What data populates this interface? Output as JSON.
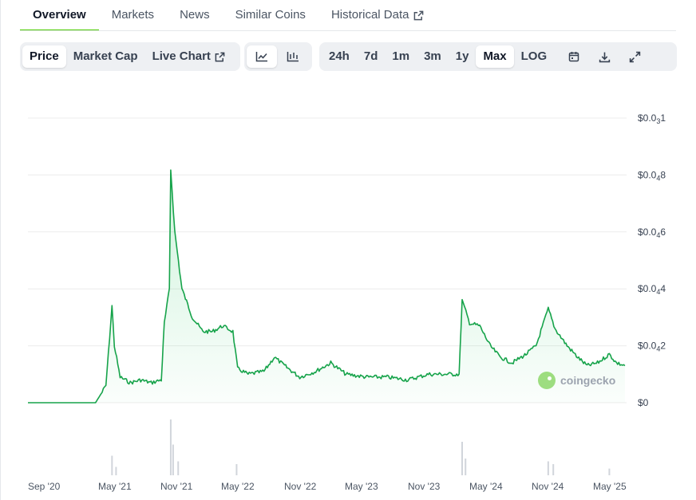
{
  "tabs": [
    {
      "label": "Overview"
    },
    {
      "label": "Markets"
    },
    {
      "label": "News"
    },
    {
      "label": "Similar Coins"
    },
    {
      "label": "Historical Data"
    }
  ],
  "toolbar": {
    "metric_buttons": [
      {
        "label": "Price"
      },
      {
        "label": "Market Cap"
      },
      {
        "label": "Live Chart"
      }
    ],
    "chart_style_icons": [
      "line-chart-icon",
      "candlestick-chart-icon"
    ],
    "range_buttons": [
      {
        "label": "24h"
      },
      {
        "label": "7d"
      },
      {
        "label": "1m"
      },
      {
        "label": "3m"
      },
      {
        "label": "1y"
      },
      {
        "label": "Max"
      },
      {
        "label": "LOG"
      }
    ],
    "selected_metric": "Price",
    "selected_range": "Max",
    "selected_style": "line",
    "tool_icons": [
      "calendar-icon",
      "download-icon",
      "fullscreen-icon"
    ]
  },
  "watermark": {
    "text": "coingecko",
    "icon": "coingecko-logo-icon"
  },
  "colors": {
    "accent": "#4bcc00",
    "line": "#16a34a",
    "fill": "#dcfce7",
    "volume": "#d1d5db"
  },
  "chart_data": {
    "type": "area",
    "grid": true,
    "legend": "none",
    "y_unit": "USD",
    "y_ticks": [
      {
        "main": "$0",
        "sub": "",
        "tail": ""
      },
      {
        "main": "$0.0",
        "sub": "4",
        "tail": "2"
      },
      {
        "main": "$0.0",
        "sub": "4",
        "tail": "4"
      },
      {
        "main": "$0.0",
        "sub": "4",
        "tail": "6"
      },
      {
        "main": "$0.0",
        "sub": "4",
        "tail": "8"
      },
      {
        "main": "$0.0",
        "sub": "3",
        "tail": "1"
      }
    ],
    "y_tick_values": [
      0,
      2e-06,
      4e-06,
      6e-06,
      8e-06,
      1e-05
    ],
    "ylim": [
      0,
      1e-05
    ],
    "x_ticks": [
      "Sep '20",
      "May '21",
      "Nov '21",
      "May '22",
      "Nov '22",
      "May '23",
      "Nov '23",
      "May '24",
      "Nov '24",
      "May '25"
    ],
    "xlim": [
      "2020-09-01",
      "2025-07-10"
    ],
    "series": [
      {
        "values": [
          [
            "2020-09-01",
            0.0
          ],
          [
            "2021-03-20",
            0.0
          ],
          [
            "2021-04-05",
            3e-07
          ],
          [
            "2021-04-20",
            6e-07
          ],
          [
            "2021-05-08",
            3.4e-06
          ],
          [
            "2021-05-15",
            2e-06
          ],
          [
            "2021-06-01",
            9e-07
          ],
          [
            "2021-07-01",
            7e-07
          ],
          [
            "2021-08-01",
            8e-07
          ],
          [
            "2021-09-01",
            7e-07
          ],
          [
            "2021-10-01",
            8e-07
          ],
          [
            "2021-10-10",
            2.8e-06
          ],
          [
            "2021-10-25",
            4e-06
          ],
          [
            "2021-10-29",
            8.2e-06
          ],
          [
            "2021-11-10",
            6e-06
          ],
          [
            "2021-12-01",
            4e-06
          ],
          [
            "2022-01-01",
            3e-06
          ],
          [
            "2022-02-01",
            2.5e-06
          ],
          [
            "2022-03-01",
            2.5e-06
          ],
          [
            "2022-04-01",
            2.7e-06
          ],
          [
            "2022-05-01",
            2.5e-06
          ],
          [
            "2022-05-15",
            1.2e-06
          ],
          [
            "2022-06-15",
            1e-06
          ],
          [
            "2022-08-01",
            1.1e-06
          ],
          [
            "2022-09-01",
            1.6e-06
          ],
          [
            "2022-10-01",
            1.3e-06
          ],
          [
            "2022-11-15",
            9e-07
          ],
          [
            "2023-01-01",
            1.1e-06
          ],
          [
            "2023-02-15",
            1.4e-06
          ],
          [
            "2023-04-01",
            1e-06
          ],
          [
            "2023-06-01",
            9e-07
          ],
          [
            "2023-08-01",
            9e-07
          ],
          [
            "2023-10-01",
            8e-07
          ],
          [
            "2023-12-01",
            1e-06
          ],
          [
            "2024-02-01",
            1e-06
          ],
          [
            "2024-03-01",
            1e-06
          ],
          [
            "2024-03-10",
            3.6e-06
          ],
          [
            "2024-04-01",
            2.8e-06
          ],
          [
            "2024-05-01",
            2.7e-06
          ],
          [
            "2024-06-01",
            2e-06
          ],
          [
            "2024-07-01",
            1.6e-06
          ],
          [
            "2024-08-05",
            1.4e-06
          ],
          [
            "2024-09-15",
            1.7e-06
          ],
          [
            "2024-10-15",
            2e-06
          ],
          [
            "2024-11-20",
            3.3e-06
          ],
          [
            "2024-12-10",
            2.6e-06
          ],
          [
            "2025-01-15",
            2e-06
          ],
          [
            "2025-02-15",
            1.6e-06
          ],
          [
            "2025-03-15",
            1.3e-06
          ],
          [
            "2025-04-15",
            1.4e-06
          ],
          [
            "2025-05-20",
            1.7e-06
          ],
          [
            "2025-06-10",
            1.4e-06
          ],
          [
            "2025-07-05",
            1.3e-06
          ]
        ]
      }
    ],
    "volume": [
      [
        "2021-05-08",
        0.35
      ],
      [
        "2021-05-20",
        0.15
      ],
      [
        "2021-10-29",
        1.0
      ],
      [
        "2021-11-05",
        0.55
      ],
      [
        "2021-11-20",
        0.25
      ],
      [
        "2022-05-12",
        0.2
      ],
      [
        "2024-03-10",
        0.6
      ],
      [
        "2024-03-20",
        0.3
      ],
      [
        "2024-11-20",
        0.25
      ],
      [
        "2024-12-05",
        0.2
      ],
      [
        "2025-05-20",
        0.12
      ]
    ]
  }
}
